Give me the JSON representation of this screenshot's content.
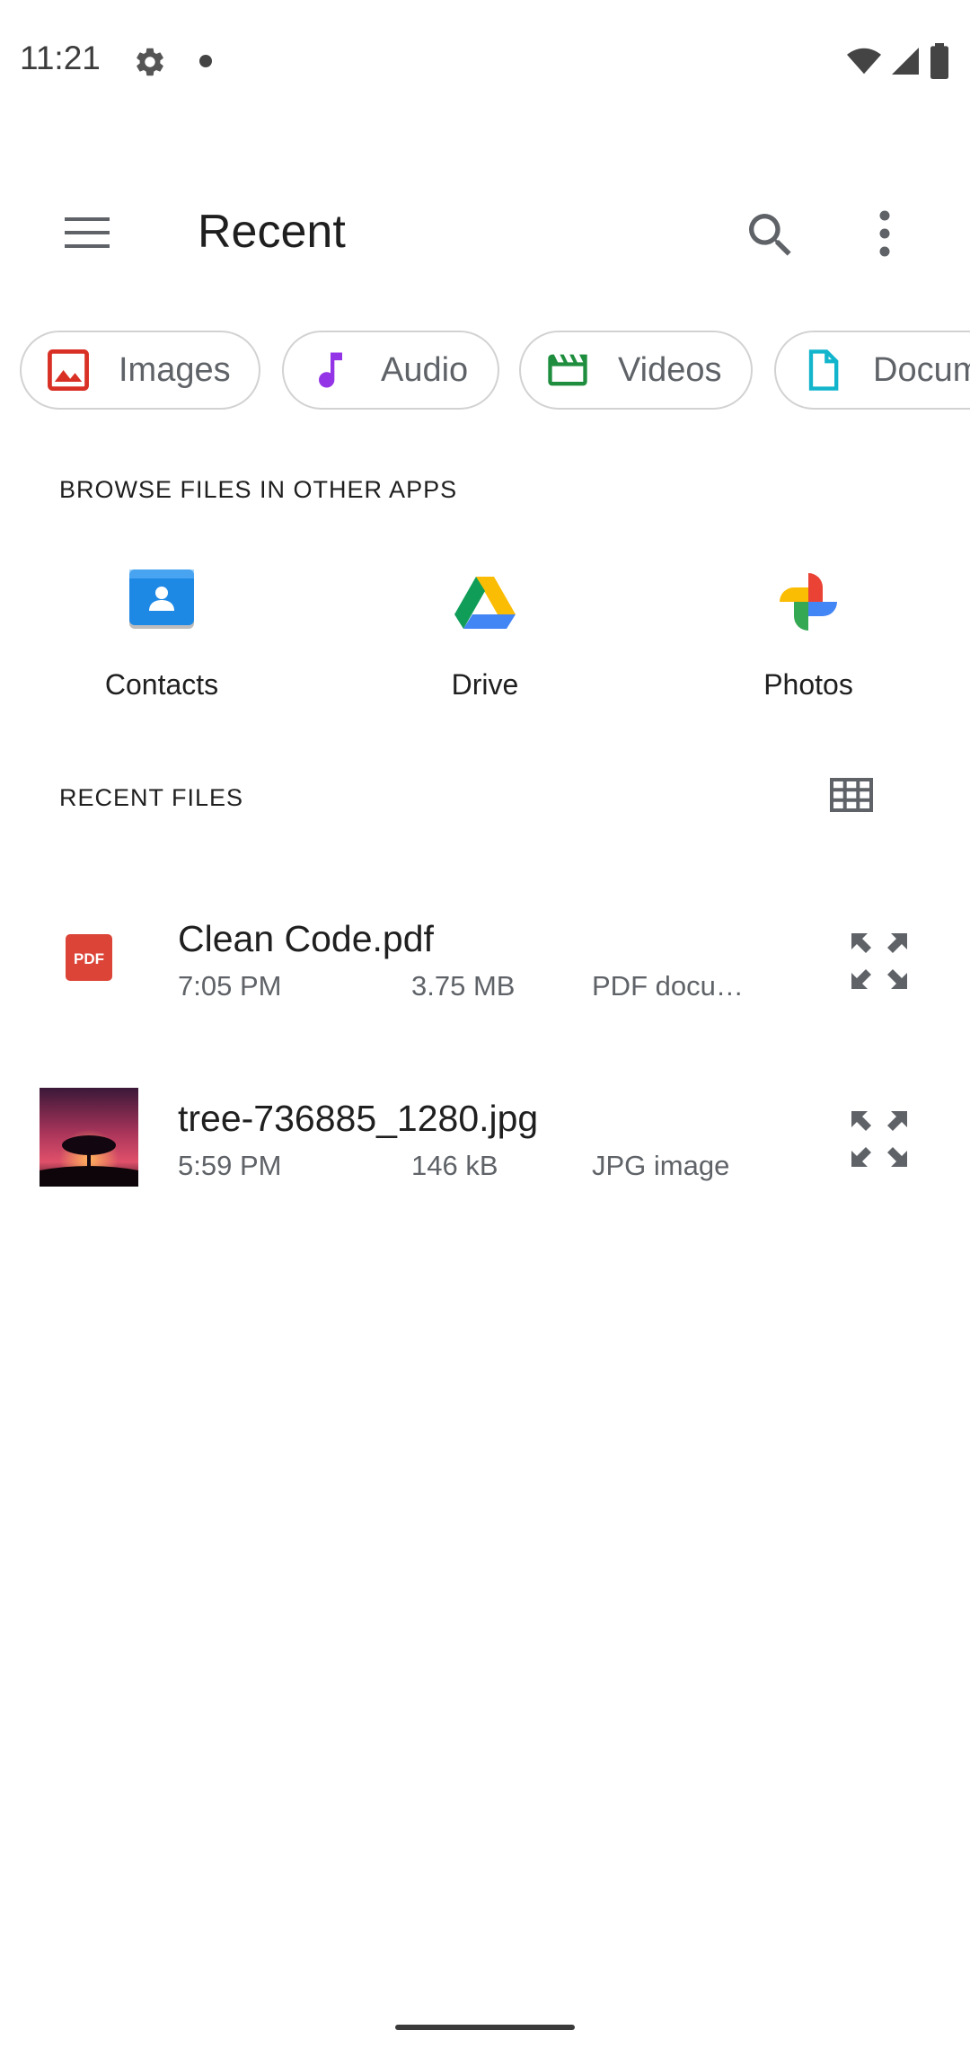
{
  "status_bar": {
    "time": "11:21",
    "icons": [
      "settings-gear-icon",
      "notification-dot-icon",
      "wifi-icon",
      "cell-signal-icon",
      "battery-icon"
    ]
  },
  "toolbar": {
    "title": "Recent",
    "menu_icon": "hamburger-menu-icon",
    "search_icon": "search-icon",
    "more_icon": "more-vert-icon"
  },
  "chips": [
    {
      "label": "Images",
      "icon": "image-icon",
      "color": "#d93025"
    },
    {
      "label": "Audio",
      "icon": "music-note-icon",
      "color": "#9334e6"
    },
    {
      "label": "Videos",
      "icon": "movie-clapper-icon",
      "color": "#1e8e3e"
    },
    {
      "label": "Documents",
      "icon": "document-icon",
      "color": "#12b5cb"
    }
  ],
  "browse_section": {
    "label": "BROWSE FILES IN OTHER APPS",
    "apps": [
      {
        "label": "Contacts",
        "icon": "contacts-icon"
      },
      {
        "label": "Drive",
        "icon": "google-drive-icon"
      },
      {
        "label": "Photos",
        "icon": "google-photos-icon"
      }
    ]
  },
  "recent_section": {
    "label": "RECENT FILES",
    "view_toggle_icon": "grid-view-icon",
    "files": [
      {
        "name": "Clean Code.pdf",
        "time": "7:05 PM",
        "size": "3.75 MB",
        "type": "PDF docu…",
        "thumb": "pdf-file-icon"
      },
      {
        "name": "tree-736885_1280.jpg",
        "time": "5:59 PM",
        "size": "146 kB",
        "type": "JPG image",
        "thumb": "image-thumbnail"
      }
    ]
  },
  "colors": {
    "accent_red": "#db4437",
    "text_primary": "#1f1f1f",
    "text_secondary": "#5f6368",
    "chip_border": "#d2d2d2"
  }
}
